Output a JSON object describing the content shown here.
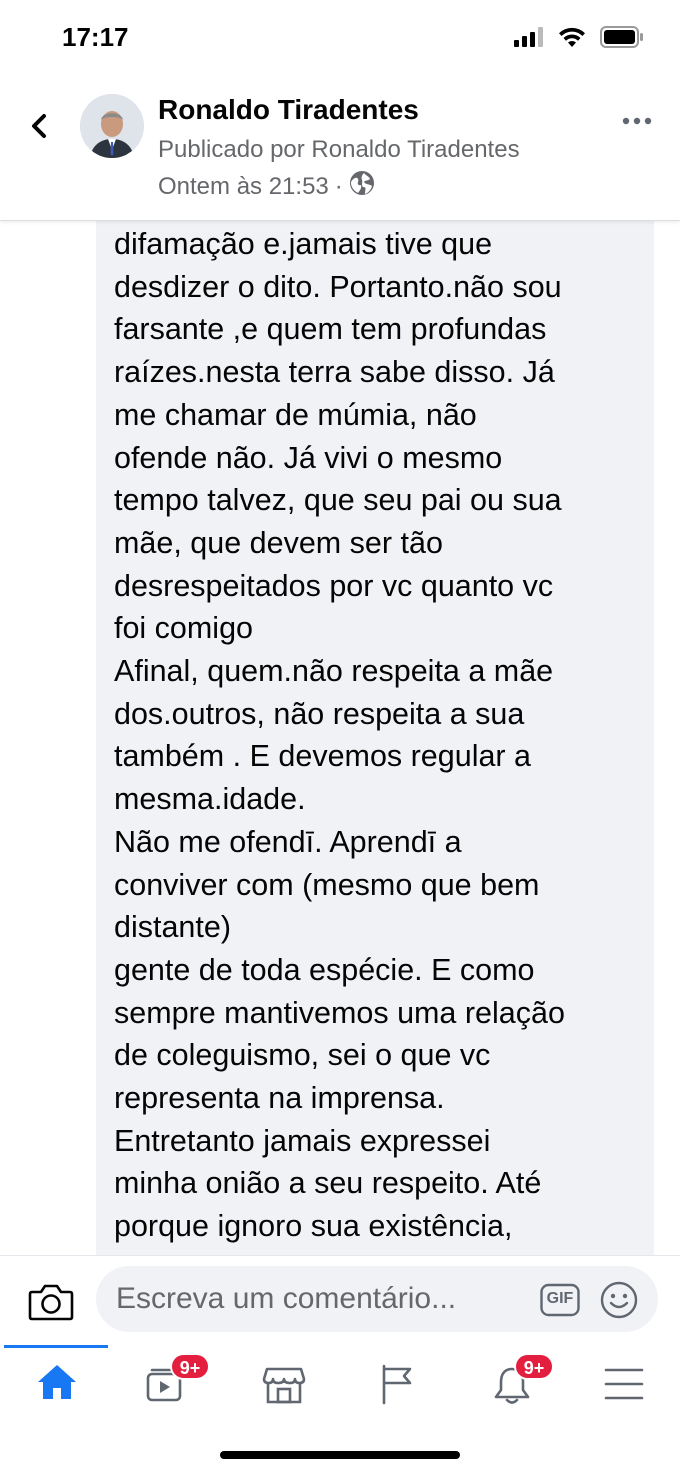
{
  "status_bar": {
    "time": "17:17",
    "icons": [
      "signal-icon",
      "wifi-icon",
      "battery-icon"
    ]
  },
  "header": {
    "author_name": "Ronaldo Tiradentes",
    "published_by": "Publicado por Ronaldo Tiradentes",
    "timestamp": "Ontem às 21:53",
    "separator": "·",
    "privacy_icon": "globe-icon",
    "back_icon": "chevron-left-icon",
    "more_icon": "more-horizontal-icon"
  },
  "comment": {
    "lines": [
      "difamação e.jamais tive que",
      "desdizer o dito. Portanto.não sou",
      "farsante ,e quem tem profundas",
      "raízes.nesta terra sabe disso. Já",
      "me chamar de múmia, não",
      "ofende não. Já vivi o mesmo",
      "tempo talvez, que seu pai ou sua",
      "mãe, que devem ser tão",
      "desrespeitados por vc quanto vc",
      "foi comigo",
      "Afinal, quem.não respeita a mãe",
      "dos.outros, não respeita a sua",
      "também . E devemos regular a",
      "mesma.idade.",
      "Não me ofendī. Aprendī a",
      "conviver com (mesmo que bem",
      "distante)",
      "gente de toda espécie. E como",
      "sempre mantivemos uma relação",
      "de coleguismo, sei o que vc",
      "representa na imprensa.",
      "Entretanto jamais expressei",
      "minha onião a seu respeito. Até",
      "porque ignoro sua existência,"
    ]
  },
  "composer": {
    "placeholder": "Escreva um comentário...",
    "camera_icon": "camera-icon",
    "gif_label": "GIF",
    "emoji_icon": "smiley-icon"
  },
  "bottom_nav": {
    "items": [
      {
        "name": "home",
        "icon": "home-icon",
        "active": true,
        "badge": ""
      },
      {
        "name": "watch",
        "icon": "video-icon",
        "active": false,
        "badge": "9+"
      },
      {
        "name": "marketplace",
        "icon": "marketplace-icon",
        "active": false,
        "badge": ""
      },
      {
        "name": "pages",
        "icon": "flag-icon",
        "active": false,
        "badge": ""
      },
      {
        "name": "notifications",
        "icon": "bell-icon",
        "active": false,
        "badge": "9+"
      },
      {
        "name": "menu",
        "icon": "menu-icon",
        "active": false,
        "badge": ""
      }
    ],
    "accent_color": "#1877f2",
    "badge_color": "#e41e3f"
  }
}
